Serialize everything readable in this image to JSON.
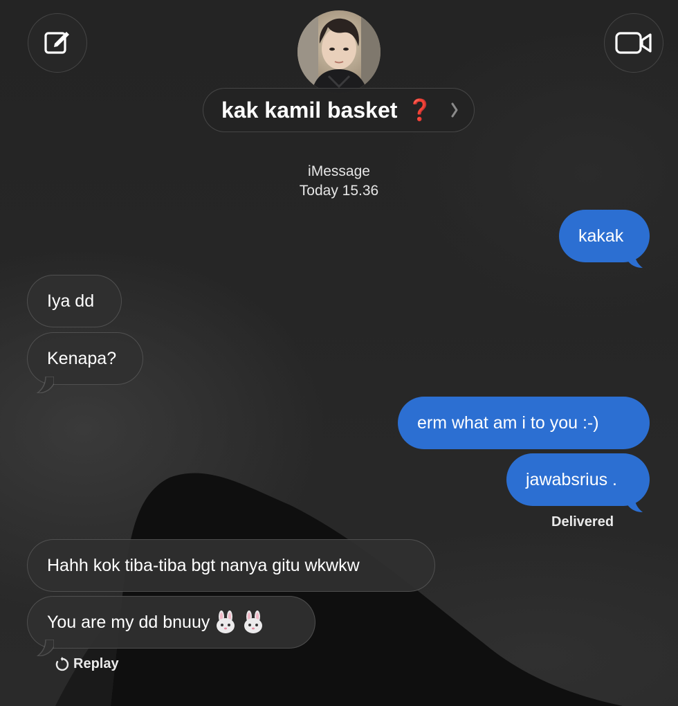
{
  "header": {
    "contact_name": "kak kamil basket",
    "name_status_glyph": "❓"
  },
  "meta": {
    "service": "iMessage",
    "time": "Today 15.36"
  },
  "messages": [
    {
      "direction": "out",
      "text": "kakak"
    },
    {
      "direction": "in",
      "text": "Iya dd"
    },
    {
      "direction": "in",
      "text": "Kenapa?"
    },
    {
      "direction": "out",
      "text": "erm what am i to you :-)"
    },
    {
      "direction": "out",
      "text": "jawabsrius ."
    },
    {
      "direction": "in",
      "text": "Hahh kok tiba-tiba bgt nanya gitu wkwkw"
    },
    {
      "direction": "in",
      "text": "You are my dd bnuuy"
    }
  ],
  "delivered_label": "Delivered",
  "replay_label": "Replay",
  "colors": {
    "outgoing_bubble": "#2c6fd2",
    "incoming_bubble": "#303030",
    "background": "#252525",
    "status_red": "#d0231e"
  },
  "icons": [
    "compose-icon",
    "video-camera-icon",
    "chevron-right-icon",
    "replay-icon",
    "rabbit-face-emoji"
  ]
}
